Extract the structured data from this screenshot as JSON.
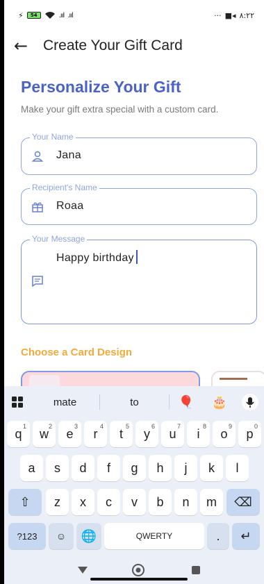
{
  "status": {
    "time": "٨:٢٢",
    "battery": "54",
    "dots": "···"
  },
  "appbar": {
    "title": "Create Your Gift Card"
  },
  "heading": "Personalize Your Gift",
  "subtitle": "Make your gift extra special with a custom card.",
  "form": {
    "your_name": {
      "label": "Your Name",
      "value": "Jana"
    },
    "recipient": {
      "label": "Recipient's Name",
      "value": "Roaa"
    },
    "message": {
      "label": "Your Message",
      "value": "Happy birthday"
    }
  },
  "design_section": {
    "title": "Choose a Card Design"
  },
  "keyboard": {
    "suggestions": [
      "mate",
      "to"
    ],
    "emoji": [
      "🎈",
      "🎂"
    ],
    "row1": [
      {
        "k": "q",
        "n": "1"
      },
      {
        "k": "w",
        "n": "2"
      },
      {
        "k": "e",
        "n": "3"
      },
      {
        "k": "r",
        "n": "4"
      },
      {
        "k": "t",
        "n": "5"
      },
      {
        "k": "y",
        "n": "6"
      },
      {
        "k": "u",
        "n": "7"
      },
      {
        "k": "i",
        "n": "8"
      },
      {
        "k": "o",
        "n": "9"
      },
      {
        "k": "p",
        "n": "0"
      }
    ],
    "row2": [
      "a",
      "s",
      "d",
      "f",
      "g",
      "h",
      "j",
      "k",
      "l"
    ],
    "row3": [
      "z",
      "x",
      "c",
      "v",
      "b",
      "n",
      "m"
    ],
    "sym_label": "?123",
    "space_label": "QWERTY",
    "period": ".",
    "accent": "#4a63c9"
  }
}
